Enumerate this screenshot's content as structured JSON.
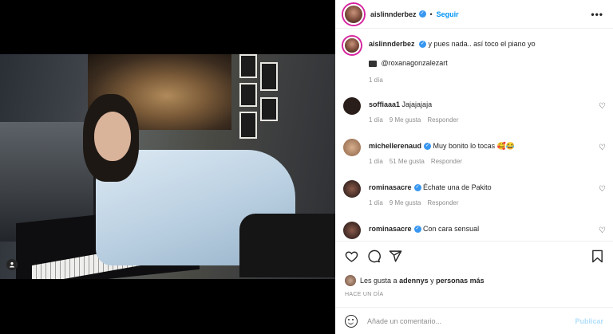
{
  "post": {
    "author": "aislinnderbez",
    "follow_label": "Seguir",
    "more_label": "•••",
    "caption_author": "aislinnderbez",
    "caption_text": "y pues nada.. así toco el piano yo",
    "credit_text": "@roxanagonzalezart",
    "caption_time": "1 día"
  },
  "comments": [
    {
      "username": "soffiaaa1",
      "verified": false,
      "text": "Jajajajaja",
      "time": "1 día",
      "likes": "9 Me gusta",
      "reply": "Responder",
      "avatar_color": "#2a1e1a"
    },
    {
      "username": "michellerenaud",
      "verified": true,
      "text": "Muy bonito lo tocas 🥰😂",
      "time": "1 día",
      "likes": "51 Me gusta",
      "reply": "Responder",
      "avatar_color": "#b08a6a"
    },
    {
      "username": "rominasacre",
      "verified": true,
      "text": "Échate una de Pakito",
      "time": "1 día",
      "likes": "9 Me gusta",
      "reply": "Responder",
      "avatar_color": "#1c1414"
    },
    {
      "username": "rominasacre",
      "verified": true,
      "text": "Con cara sensual",
      "time": "",
      "likes": "",
      "reply": "",
      "avatar_color": "#1c1414"
    }
  ],
  "actions": {
    "likes_prefix": "Les gusta a",
    "likes_user": "adennys",
    "likes_and": "y",
    "likes_others": "personas más",
    "posted_time": "HACE UN DÍA"
  },
  "composer": {
    "placeholder": "Añade un comentario...",
    "publish_label": "Publicar"
  },
  "colors": {
    "accent": "#0095f6",
    "verified": "#3897f0",
    "muted": "#8e8e8e"
  }
}
